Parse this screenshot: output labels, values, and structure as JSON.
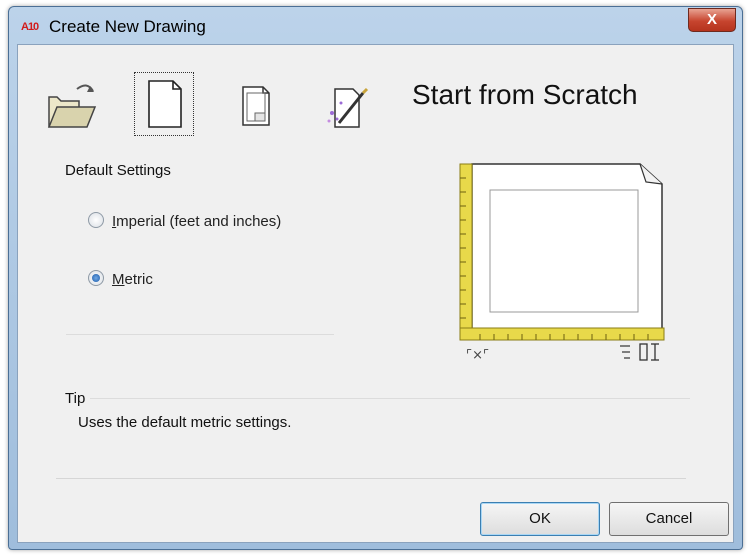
{
  "window": {
    "title": "Create New Drawing",
    "app_icon_text": "A10",
    "close_label": "X"
  },
  "toolbar": {
    "items": [
      {
        "name": "open-drawing-button",
        "icon": "open-folder-icon"
      },
      {
        "name": "start-from-scratch-button",
        "icon": "blank-page-icon",
        "selected": true
      },
      {
        "name": "use-template-button",
        "icon": "template-page-icon"
      },
      {
        "name": "use-wizard-button",
        "icon": "wizard-page-icon"
      }
    ]
  },
  "heading": "Start from Scratch",
  "settings": {
    "label": "Default Settings",
    "options": [
      {
        "accel": "I",
        "rest": "mperial (feet and inches)",
        "selected": false
      },
      {
        "accel": "M",
        "rest": "etric",
        "selected": true
      }
    ]
  },
  "preview": {
    "dim_xy": "⌜×⌜"
  },
  "tip": {
    "label": "Tip",
    "text": "Uses the default metric settings."
  },
  "buttons": {
    "ok": "OK",
    "cancel": "Cancel"
  },
  "colors": {
    "ruler": "#e8d94a",
    "close_button": "#c7452f"
  }
}
